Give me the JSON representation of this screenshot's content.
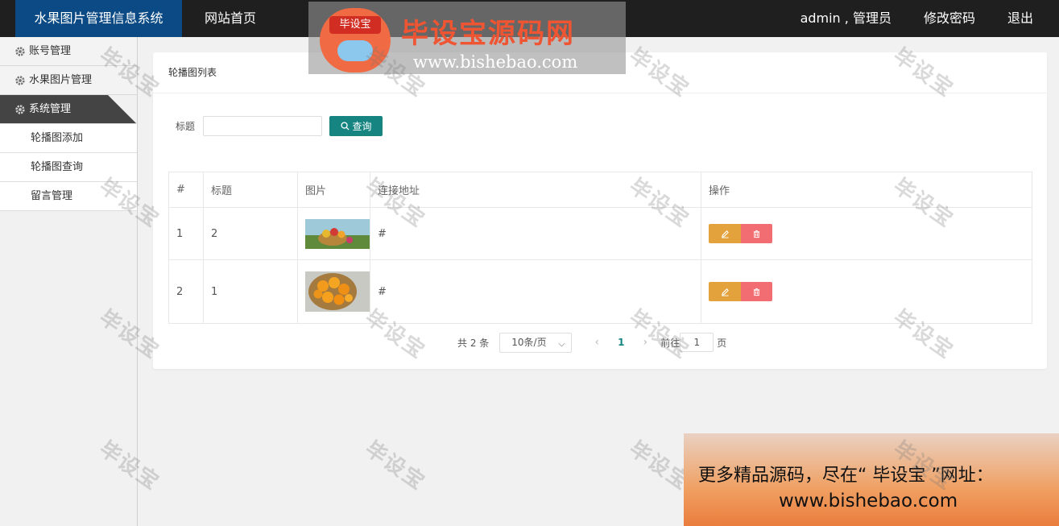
{
  "header": {
    "app_title": "水果图片管理信息系统",
    "home_link": "网站首页",
    "user": "admin , 管理员",
    "change_password": "修改密码",
    "logout": "退出"
  },
  "sidebar": {
    "items": [
      {
        "label": "账号管理"
      },
      {
        "label": "水果图片管理"
      },
      {
        "label": "系统管理"
      }
    ],
    "sub_items": [
      {
        "label": "轮播图添加"
      },
      {
        "label": "轮播图查询"
      },
      {
        "label": "留言管理"
      }
    ]
  },
  "main": {
    "card_title": "轮播图列表",
    "search_label": "标题",
    "search_value": "",
    "search_button": "查询",
    "table": {
      "headers": [
        "#",
        "标题",
        "图片",
        "连接地址",
        "操作"
      ],
      "rows": [
        {
          "index": "1",
          "title": "2",
          "link": "#"
        },
        {
          "index": "2",
          "title": "1",
          "link": "#"
        }
      ]
    },
    "pager": {
      "total": "共 2 条",
      "page_size": "10条/页",
      "current": "1",
      "goto_label": "前往",
      "goto_value": "1",
      "page_unit": "页"
    }
  },
  "watermark": {
    "text": "毕设宝",
    "logo_badge": "毕设宝",
    "logo_name": "毕设宝源码网",
    "logo_url": "www.bishebao.com"
  },
  "promo": {
    "line1": "更多精品源码，尽在“ 毕设宝 ”网址：",
    "line2": "www.bishebao.com"
  },
  "colors": {
    "topbar": "#1f1f1f",
    "brand": "#0b4a84",
    "primary": "#168581",
    "edit": "#e3a23b",
    "delete": "#f16d72"
  }
}
